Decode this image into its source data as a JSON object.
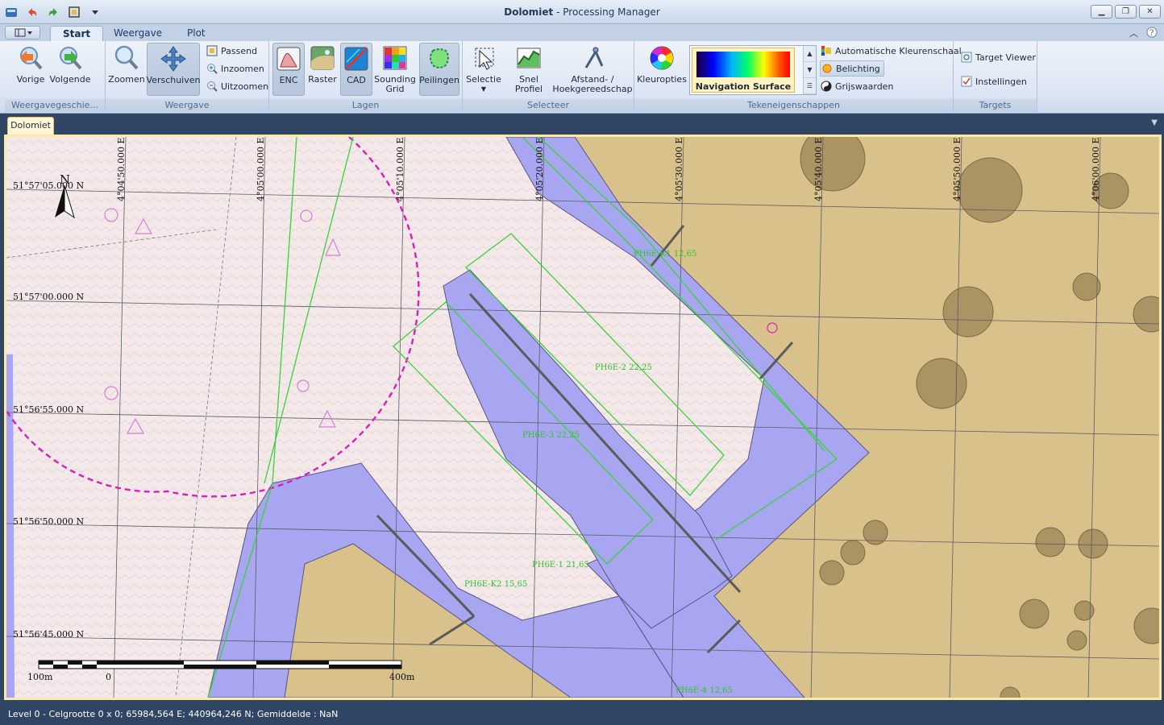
{
  "window": {
    "title_app": "Dolomiet",
    "title_rest": " - Processing Manager",
    "controls": [
      "minimize-icon",
      "restore-icon",
      "close-icon"
    ]
  },
  "ribbon": {
    "tabs": [
      "Start",
      "Weergave",
      "Plot"
    ],
    "active_tab": "Start",
    "groups": {
      "history": {
        "label": "Weergavegeschie...",
        "previous": "Vorige",
        "next": "Volgende"
      },
      "view": {
        "label": "Weergave",
        "zoom": "Zoomen",
        "pan": "Verschuiven",
        "fit": "Passend",
        "zoom_in": "Inzoomen",
        "zoom_out": "Uitzoomen"
      },
      "layers": {
        "label": "Lagen",
        "enc": "ENC",
        "raster": "Raster",
        "cad": "CAD",
        "sounding_grid_1": "Sounding",
        "sounding_grid_2": "Grid",
        "surveys": "Peilingen"
      },
      "select": {
        "label": "Selecteer",
        "selection": "Selectie",
        "quick_profile": "Snel Profiel",
        "distance_1": "Afstand- /",
        "distance_2": "Hoekgereedschap"
      },
      "draw": {
        "label": "Tekeneigenschappen",
        "color_options": "Kleuropties",
        "surface": "Navigation Surface",
        "auto_color": "Automatische Kleurenschaal",
        "lighting": "Belichting",
        "grayscale": "Grijswaarden"
      },
      "targets": {
        "label": "Targets",
        "viewer": "Target Viewer",
        "settings": "Instellingen"
      }
    }
  },
  "document": {
    "tab": "Dolomiet"
  },
  "map": {
    "lat_labels": [
      "51°57'05.000 N",
      "51°57'00.000 N",
      "51°56'55.000 N",
      "51°56'50.000 N",
      "51°56'45.000 N"
    ],
    "lon_labels": [
      "4°04'50.000 E",
      "4°05'00.000 E",
      "4°05'10.000 E",
      "4°05'20.000 E",
      "4°05'30.000 E",
      "4°05'40.000 E",
      "4°05'50.000 E",
      "4°06'00.000 E"
    ],
    "north": "N",
    "scale_labels": [
      "100m",
      "0",
      "400m"
    ],
    "area_labels": [
      "PH6E-K1 12,65",
      "PH6E-2 22,25",
      "PH6E-3 22,25",
      "PH6E-1 21,65",
      "PH6E-K2 15,65",
      "PH6E-4 12,65"
    ],
    "colors": {
      "land": "#d8c18a",
      "shallow": "#f4e8e8",
      "channel": "#a8a6f0",
      "contour": "#6a5f7a",
      "outline": "#3ad23a",
      "circle": "#d61fbd"
    }
  },
  "status": {
    "text": "Level 0 - Celgrootte 0 x 0; 65984,564 E; 440964,246 N; Gemiddelde : NaN"
  }
}
